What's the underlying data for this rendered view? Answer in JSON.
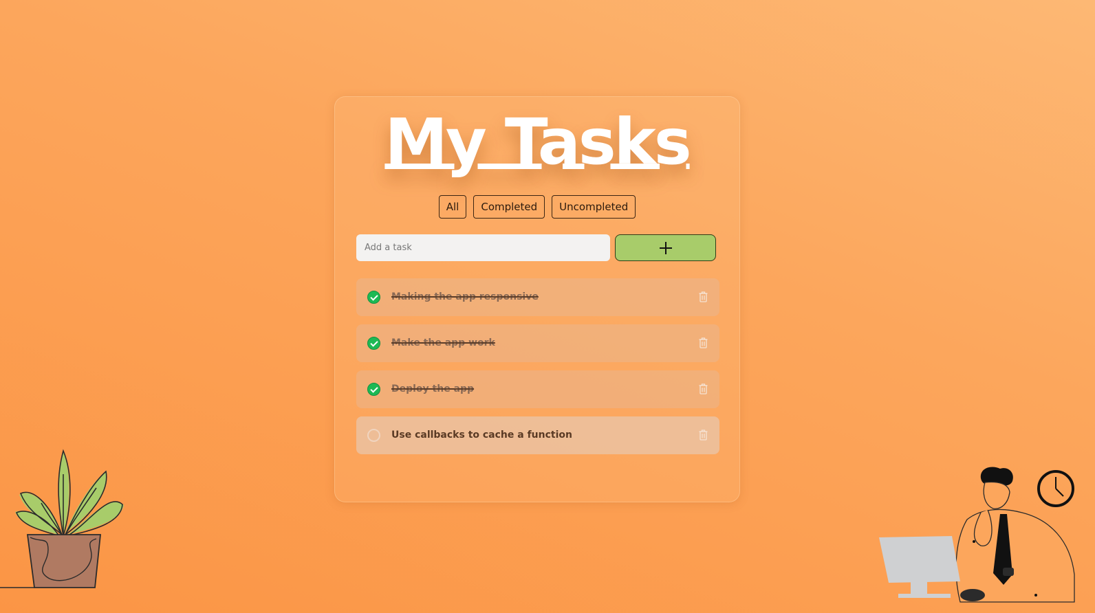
{
  "app": {
    "title": "My Tasks"
  },
  "filters": [
    {
      "label": "All"
    },
    {
      "label": "Completed"
    },
    {
      "label": "Uncompleted"
    }
  ],
  "add": {
    "placeholder": "Add a task",
    "button_icon": "plus-icon"
  },
  "tasks": [
    {
      "text": "Making the app responsive",
      "completed": true
    },
    {
      "text": "Make the app work",
      "completed": true
    },
    {
      "text": "Deploy the app",
      "completed": true
    },
    {
      "text": "Use callbacks to cache a function",
      "completed": false
    }
  ],
  "icons": {
    "check": "check-icon",
    "delete": "trash-icon"
  },
  "colors": {
    "background": "#fca65c",
    "add_button": "#a8cc6a",
    "check_done": "#1db954",
    "title": "#ffffff"
  }
}
